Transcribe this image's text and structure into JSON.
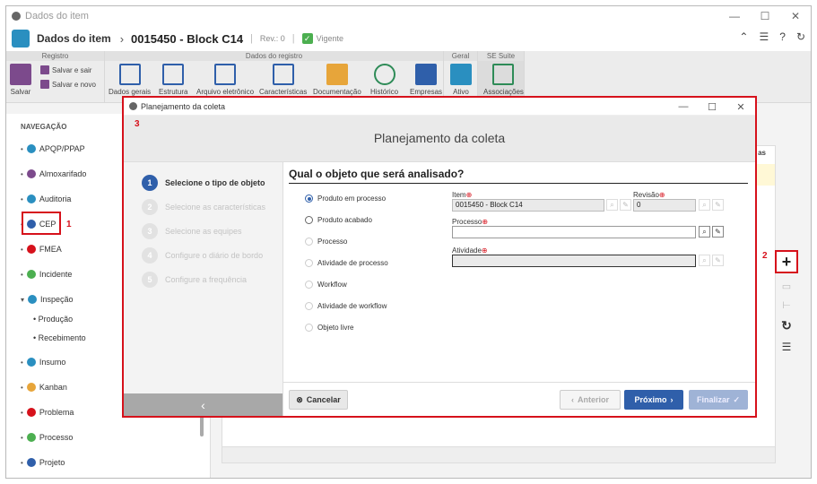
{
  "window": {
    "title": "Dados do item",
    "controls": [
      "—",
      "☐",
      "✕"
    ]
  },
  "header": {
    "section": "Dados do item",
    "item_title": "0015450 - Block C14",
    "revision": "Rev.: 0",
    "status": "Vigente"
  },
  "ribbon": {
    "groups": [
      "Registro",
      "Dados do registro",
      "Geral",
      "SE Suite"
    ],
    "save": "Salvar",
    "save_exit": "Salvar e sair",
    "save_new": "Salvar e novo",
    "buttons": [
      "Dados gerais",
      "Estrutura",
      "Arquivo eletrônico",
      "Características",
      "Documentação",
      "Histórico",
      "Empresas"
    ],
    "geral": "Ativo",
    "sesuite": "Associações"
  },
  "nav": {
    "header": "NAVEGAÇÃO",
    "items": [
      "APQP/PPAP",
      "Almoxarifado",
      "Auditoria",
      "CEP",
      "FMEA",
      "Incidente",
      "Inspeção",
      "Insumo",
      "Kanban",
      "Problema",
      "Processo",
      "Projeto"
    ],
    "subitems": [
      "Produção",
      "Recebimento"
    ]
  },
  "annotations": {
    "a1": "1",
    "a2": "2",
    "a3": "3"
  },
  "dialog": {
    "title": "Planejamento da coleta",
    "heading": "Planejamento da coleta",
    "steps": [
      {
        "num": "1",
        "label": "Selecione o tipo de objeto"
      },
      {
        "num": "2",
        "label": "Selecione as características"
      },
      {
        "num": "3",
        "label": "Selecione as equipes"
      },
      {
        "num": "4",
        "label": "Configure o diário de bordo"
      },
      {
        "num": "5",
        "label": "Configure a frequência"
      }
    ],
    "question": "Qual o objeto que será analisado?",
    "options": [
      "Produto em processo",
      "Produto acabado",
      "Processo",
      "Atividade de processo",
      "Workflow",
      "Atividade de workflow",
      "Objeto livre"
    ],
    "fields": {
      "item_label": "Item",
      "item_value": "0015450 - Block C14",
      "revisao_label": "Revisão",
      "revisao_value": "0",
      "processo_label": "Processo",
      "processo_value": "",
      "atividade_label": "Atividade",
      "atividade_value": ""
    },
    "buttons": {
      "cancel": "Cancelar",
      "previous": "Anterior",
      "next": "Próximo",
      "finish": "Finalizar"
    }
  },
  "background_col": "as"
}
